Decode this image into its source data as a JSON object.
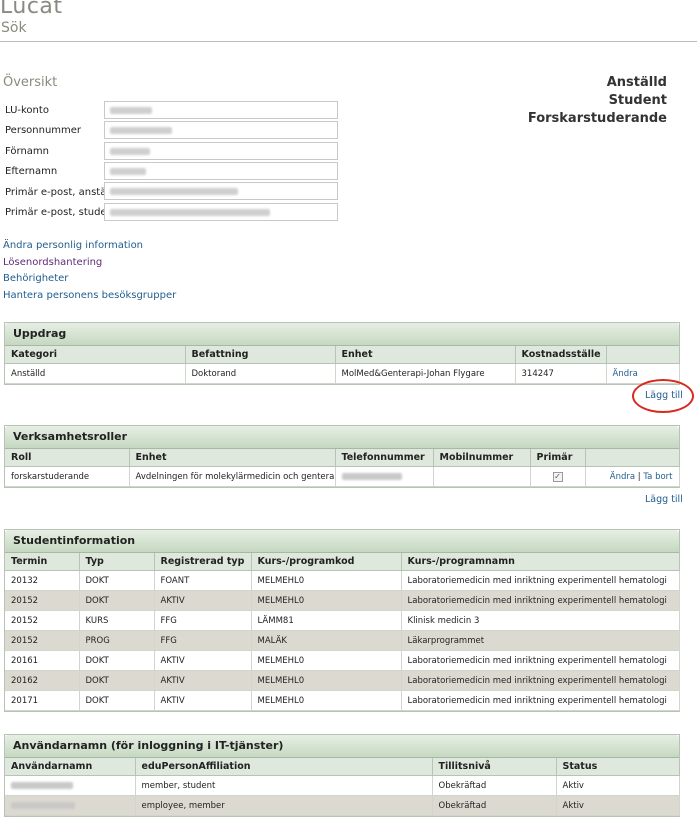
{
  "header": {
    "title": "Lucat",
    "subtitle": "Sök"
  },
  "overview": {
    "title": "Översikt",
    "roles": [
      "Anställd",
      "Student",
      "Forskarstuderande"
    ],
    "fields": [
      {
        "label": "LU-konto"
      },
      {
        "label": "Personnummer"
      },
      {
        "label": "Förnamn"
      },
      {
        "label": "Efternamn"
      },
      {
        "label": "Primär e-post, anställd"
      },
      {
        "label": "Primär e-post, student"
      }
    ]
  },
  "links": {
    "edit_personal": "Ändra personlig information",
    "password": "Lösenordshantering",
    "permissions": "Behörigheter",
    "visitor_groups": "Hantera personens besöksgrupper"
  },
  "uppdrag": {
    "title": "Uppdrag",
    "columns": [
      "Kategori",
      "Befattning",
      "Enhet",
      "Kostnadsställe",
      ""
    ],
    "rows": [
      [
        "Anställd",
        "Doktorand",
        "MolMed&Genterapi-Johan Flygare",
        "314247"
      ]
    ],
    "edit_label": "Ändra",
    "add_label": "Lägg till"
  },
  "verksamhet": {
    "title": "Verksamhetsroller",
    "columns": [
      "Roll",
      "Enhet",
      "Telefonnummer",
      "Mobilnummer",
      "Primär",
      ""
    ],
    "rows": [
      [
        "forskarstuderande",
        "Avdelningen för molekylärmedicin och genterapi",
        "",
        ""
      ]
    ],
    "primary_checked": true,
    "edit_label": "Ändra",
    "remove_label": "Ta bort",
    "separator": "|",
    "add_label": "Lägg till"
  },
  "student": {
    "title": "Studentinformation",
    "columns": [
      "Termin",
      "Typ",
      "Registrerad typ",
      "Kurs-/programkod",
      "Kurs-/programnamn"
    ],
    "rows": [
      [
        "20132",
        "DOKT",
        "FOANT",
        "MELMEHL0",
        "Laboratoriemedicin med inriktning experimentell hematologi"
      ],
      [
        "20152",
        "DOKT",
        "AKTIV",
        "MELMEHL0",
        "Laboratoriemedicin med inriktning experimentell hematologi"
      ],
      [
        "20152",
        "KURS",
        "FFG",
        "LÄMM81",
        "Klinisk medicin 3"
      ],
      [
        "20152",
        "PROG",
        "FFG",
        "MALÄK",
        "Läkarprogrammet"
      ],
      [
        "20161",
        "DOKT",
        "AKTIV",
        "MELMEHL0",
        "Laboratoriemedicin med inriktning experimentell hematologi"
      ],
      [
        "20162",
        "DOKT",
        "AKTIV",
        "MELMEHL0",
        "Laboratoriemedicin med inriktning experimentell hematologi"
      ],
      [
        "20171",
        "DOKT",
        "AKTIV",
        "MELMEHL0",
        "Laboratoriemedicin med inriktning experimentell hematologi"
      ]
    ]
  },
  "usernames": {
    "title": "Användarnamn (för inloggning i IT-tjänster)",
    "columns": [
      "Användarnamn",
      "eduPersonAffiliation",
      "Tillitsnivå",
      "Status"
    ],
    "rows": [
      [
        "",
        "member, student",
        "Obekräftad",
        "Aktiv"
      ],
      [
        "",
        "employee, member",
        "Obekräftad",
        "Aktiv"
      ]
    ]
  }
}
